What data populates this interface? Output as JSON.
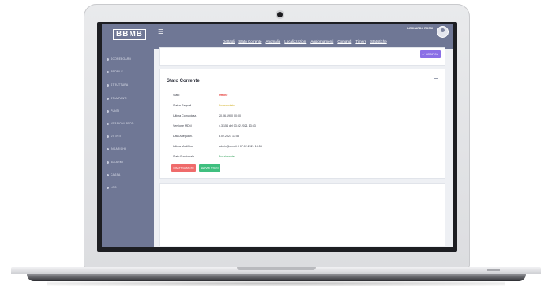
{
  "app": {
    "logo": "BBMB"
  },
  "sidebar": {
    "items": [
      {
        "label": "Scoreboard"
      },
      {
        "label": "Profile"
      },
      {
        "label": "Struttura"
      },
      {
        "label": "Stampanti"
      },
      {
        "label": "Punti"
      },
      {
        "label": "Versioni Prod"
      },
      {
        "label": "Utenti"
      },
      {
        "label": "Incarichi"
      },
      {
        "label": "Allarmi"
      },
      {
        "label": "Cassa"
      },
      {
        "label": "Log"
      }
    ]
  },
  "topbar": {
    "user_name": "LEONARDO ROSSI",
    "tabs": [
      "Dettagli",
      "Stato Corrente",
      "Anomalie",
      "Localizzazioni",
      "Aggiornamenti",
      "Comandi",
      "Timers",
      "Statistiche"
    ]
  },
  "actions": {
    "edit_label": "✓ MODIFICA"
  },
  "status": {
    "title": "Stato Corrente",
    "rows": [
      {
        "label": "Stato",
        "value": "Offline",
        "color": "#e53935"
      },
      {
        "label": "Status Segnali",
        "value": "Sconosciuto",
        "color": "#c9a200"
      },
      {
        "label": "Ultima Comunicaz.",
        "value": "20.06.1900 00:00",
        "color": "#333642"
      },
      {
        "label": "Versione MDM",
        "value": "4.3.154 del 03.02.2021 13:53",
        "color": "#333642"
      },
      {
        "label": "Data Adeguam.",
        "value": "8.02.2021 13:53",
        "color": "#333642"
      },
      {
        "label": "Ultima Modifica",
        "value": "admin@ceru.it il 07.02.2021 13:53",
        "color": "#333642"
      },
      {
        "label": "Stato Funzionale",
        "value": "Funzionante",
        "color": "#2e9e55"
      }
    ],
    "btn_disable": "DISATTIVA STATO",
    "btn_enable": "SERVIZI STATO"
  },
  "colors": {
    "sidebar": "#6f7795",
    "accent": "#8a6fe6",
    "danger": "#ef6b6b",
    "success": "#3fbf7f"
  }
}
